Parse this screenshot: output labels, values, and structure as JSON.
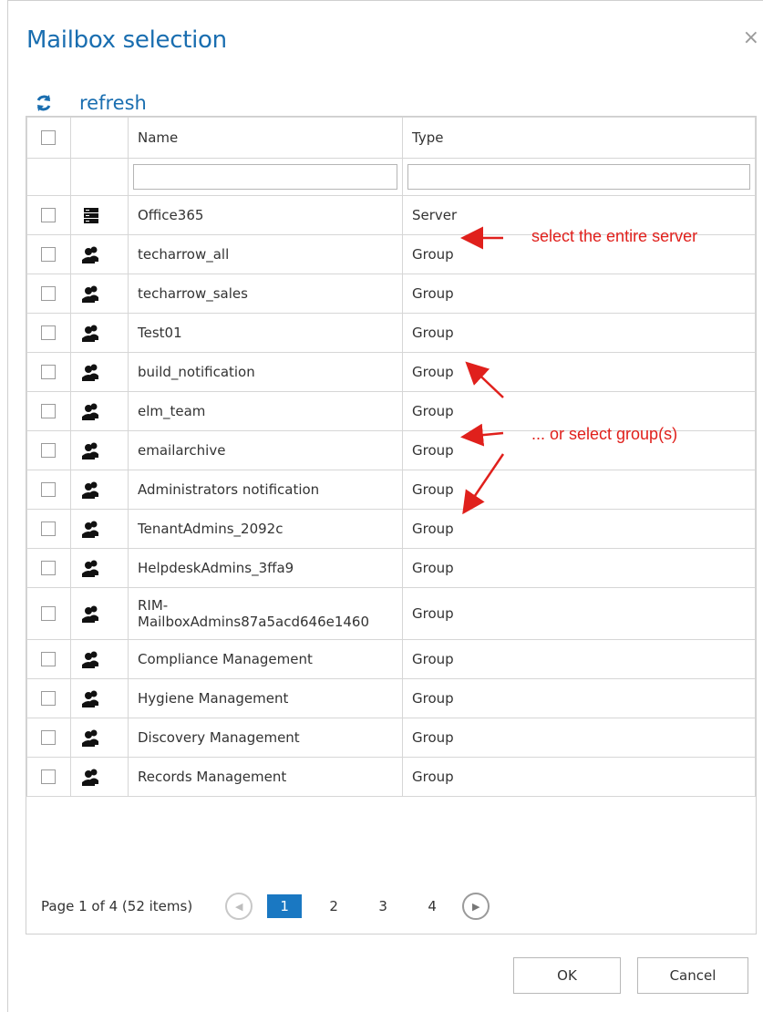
{
  "dialog": {
    "title": "Mailbox selection",
    "close_glyph": "×",
    "refresh_label": "refresh",
    "refresh_icon": "refresh-icon"
  },
  "table": {
    "columns": [
      "Name",
      "Type"
    ],
    "rows": [
      {
        "icon": "server-icon",
        "name": "Office365",
        "type": "Server"
      },
      {
        "icon": "group-icon",
        "name": "techarrow_all",
        "type": "Group"
      },
      {
        "icon": "group-icon",
        "name": "techarrow_sales",
        "type": "Group"
      },
      {
        "icon": "group-icon",
        "name": "Test01",
        "type": "Group"
      },
      {
        "icon": "group-icon",
        "name": "build_notification",
        "type": "Group"
      },
      {
        "icon": "group-icon",
        "name": "elm_team",
        "type": "Group"
      },
      {
        "icon": "group-icon",
        "name": "emailarchive",
        "type": "Group"
      },
      {
        "icon": "group-icon",
        "name": "Administrators notification",
        "type": "Group"
      },
      {
        "icon": "group-icon",
        "name": "TenantAdmins_2092c",
        "type": "Group"
      },
      {
        "icon": "group-icon",
        "name": "HelpdeskAdmins_3ffa9",
        "type": "Group"
      },
      {
        "icon": "group-icon",
        "name": "RIM-MailboxAdmins87a5acd646e1460",
        "name_line1": "RIM-",
        "name_line2": "MailboxAdmins87a5acd646e1460",
        "type": "Group"
      },
      {
        "icon": "group-icon",
        "name": "Compliance Management",
        "type": "Group"
      },
      {
        "icon": "group-icon",
        "name": "Hygiene Management",
        "type": "Group"
      },
      {
        "icon": "group-icon",
        "name": "Discovery Management",
        "type": "Group"
      },
      {
        "icon": "group-icon",
        "name": "Records Management",
        "type": "Group"
      }
    ]
  },
  "pager": {
    "info": "Page 1 of 4 (52 items)",
    "pages": [
      "1",
      "2",
      "3",
      "4"
    ],
    "current_page": "1",
    "prev_glyph": "◀",
    "next_glyph": "▶"
  },
  "buttons": {
    "ok": "OK",
    "cancel": "Cancel"
  },
  "annotations": {
    "server_note": "select the entire server",
    "group_note": "... or select group(s)",
    "color": "#e0201c"
  },
  "colors": {
    "accent": "#1a6eb0",
    "active_page": "#1a78c2"
  }
}
